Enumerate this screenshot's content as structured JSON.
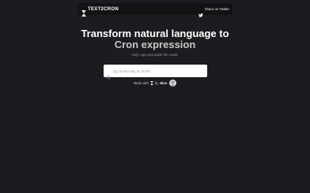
{
  "navbar": {
    "brand": "TEXT2CRON",
    "share_label": "Share on Twitter"
  },
  "hero": {
    "title_line1": "Transform natural language to",
    "title_line2": "Cron expression",
    "subtitle": "Only copy and paste the result."
  },
  "search": {
    "placeholder": "Eg. Every day at 15:00",
    "value": ""
  },
  "footer": {
    "made_with": "Made with",
    "by": "by",
    "author": "Nico"
  },
  "icons": {
    "logo": "hourglass-icon",
    "share": "twitter-bird-icon",
    "search": "search-icon",
    "footer": "hourglass-icon",
    "avatar": "avatar"
  },
  "colors": {
    "background": "#1c1b1f",
    "navbar": "#121214",
    "title": "#ffffff",
    "title_accent": "#c7c7c7",
    "subtitle": "#9a9aa0"
  }
}
